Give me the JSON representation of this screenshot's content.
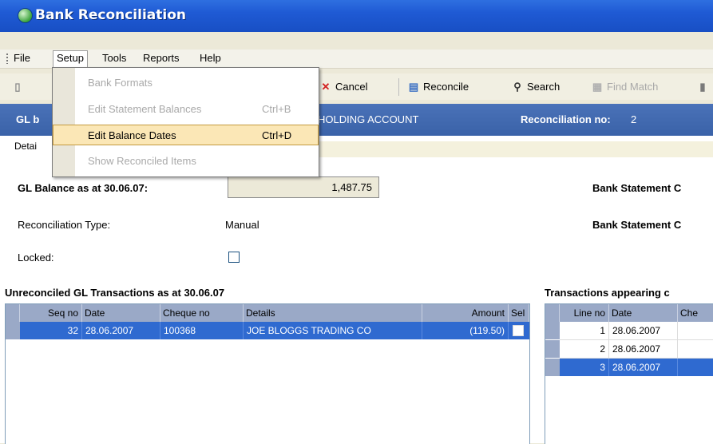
{
  "window": {
    "title": "Bank Reconciliation"
  },
  "menubar": {
    "items": [
      "File",
      "Setup",
      "Tools",
      "Reports",
      "Help"
    ],
    "active": "Setup"
  },
  "setup_menu": {
    "items": [
      {
        "label": "Bank Formats",
        "shortcut": "",
        "state": "disabled"
      },
      {
        "label": "Edit Statement Balances",
        "shortcut": "Ctrl+B",
        "state": "disabled"
      },
      {
        "label": "Edit Balance Dates",
        "shortcut": "Ctrl+D",
        "state": "highlighted"
      },
      {
        "label": "Show Reconciled Items",
        "shortcut": "",
        "state": "disabled"
      }
    ]
  },
  "toolbar": {
    "cancel": "Cancel",
    "reconcile": "Reconcile",
    "search": "Search",
    "find_match": "Find Match"
  },
  "header_bar": {
    "gl_label_partial": "GL b",
    "account_partial": "HOLDING ACCOUNT",
    "reconciliation_no_label": "Reconciliation no:",
    "reconciliation_no_value": "2"
  },
  "tab": {
    "label_partial": "Detai"
  },
  "form": {
    "gl_balance_label": "GL Balance as at 30.06.07:",
    "gl_balance_value": "1,487.75",
    "reconciliation_type_label": "Reconciliation Type:",
    "reconciliation_type_value": "Manual",
    "locked_label": "Locked:",
    "bank_statement_label_1": "Bank Statement C",
    "bank_statement_label_2": "Bank Statement C"
  },
  "unreconciled": {
    "title": "Unreconciled GL Transactions as at 30.06.07",
    "columns": [
      "Seq no",
      "Date",
      "Cheque no",
      "Details",
      "Amount",
      "Sel"
    ],
    "rows": [
      {
        "seq": "32",
        "date": "28.06.2007",
        "cheque": "100368",
        "details": "JOE BLOGGS TRADING CO",
        "amount": "(119.50)",
        "selected": true
      }
    ]
  },
  "bank_transactions": {
    "title": "Transactions appearing c",
    "columns": [
      "Line no",
      "Date",
      "Che"
    ],
    "rows": [
      {
        "line": "1",
        "date": "28.06.2007",
        "selected": false
      },
      {
        "line": "2",
        "date": "28.06.2007",
        "selected": false
      },
      {
        "line": "3",
        "date": "28.06.2007",
        "selected": true
      }
    ]
  },
  "colors": {
    "titlebar": "#1f5ad4",
    "header_bar": "#4a72b8",
    "selection": "#2f6ad0",
    "menu_highlight": "#fbe7b6"
  }
}
